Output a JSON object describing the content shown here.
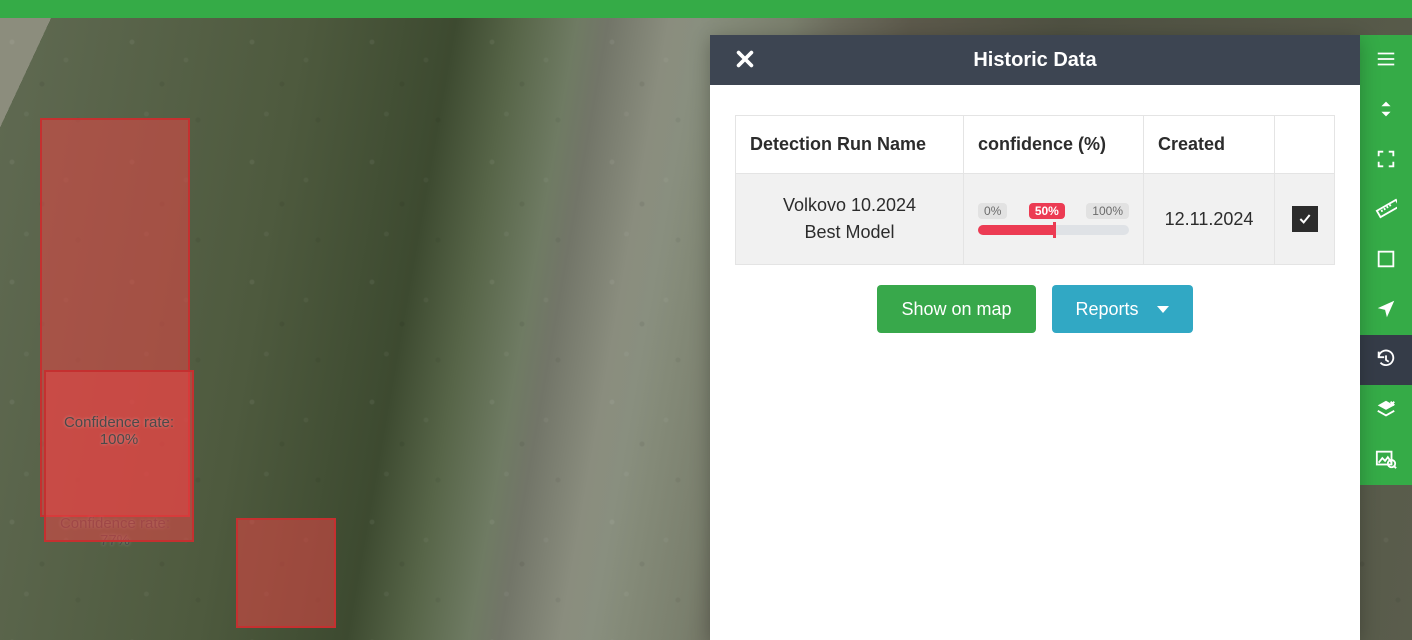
{
  "panel": {
    "title": "Historic Data",
    "columns": {
      "name": "Detection Run Name",
      "confidence": "confidence (%)",
      "created": "Created"
    },
    "rows": [
      {
        "name_line1": "Volkovo 10.2024",
        "name_line2": "Best Model",
        "conf_min": "0%",
        "conf_cur": "50%",
        "conf_max": "100%",
        "conf_value_pct": 50,
        "created": "12.11.2024",
        "selected": true
      }
    ],
    "actions": {
      "show_on_map": "Show on map",
      "reports": "Reports"
    }
  },
  "detections": [
    {
      "label": "Confidence rate:",
      "value": "77%"
    },
    {
      "label": "Confidence rate:",
      "value": "100%"
    }
  ],
  "sidetools": [
    {
      "name": "menu-icon"
    },
    {
      "name": "sort-updown-icon"
    },
    {
      "name": "fullscreen-icon"
    },
    {
      "name": "ruler-icon"
    },
    {
      "name": "square-icon"
    },
    {
      "name": "locate-icon"
    },
    {
      "name": "history-icon"
    },
    {
      "name": "layers-remove-icon"
    },
    {
      "name": "search-image-icon"
    }
  ]
}
